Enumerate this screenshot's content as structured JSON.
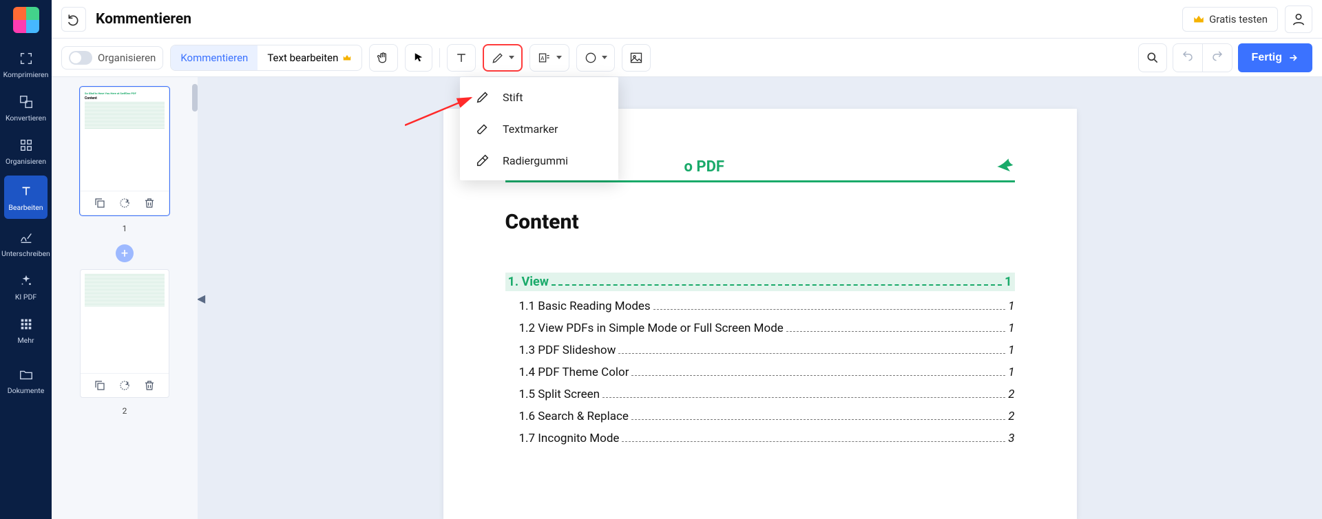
{
  "app_title": "Kommentieren",
  "topbar": {
    "trial_label": "Gratis testen"
  },
  "sidebar": {
    "items": [
      {
        "label": "Komprimieren"
      },
      {
        "label": "Konvertieren"
      },
      {
        "label": "Organisieren"
      },
      {
        "label": "Bearbeiten"
      },
      {
        "label": "Unterschreiben"
      },
      {
        "label": "KI PDF"
      },
      {
        "label": "Mehr"
      },
      {
        "label": "Dokumente"
      }
    ]
  },
  "toolbar": {
    "organize_label": "Organisieren",
    "tabs": {
      "annotate": "Kommentieren",
      "text": "Text bearbeiten"
    },
    "done_label": "Fertig"
  },
  "pen_dropdown": {
    "pen": "Stift",
    "marker": "Textmarker",
    "eraser": "Radiergummi"
  },
  "thumbnails": {
    "page1": "1",
    "page2": "2"
  },
  "document": {
    "header_title": "So Glad to Hav                     o PDF",
    "content_heading": "Content",
    "section": {
      "name": "1. View",
      "page": "1"
    },
    "toc": [
      {
        "name": "1.1 Basic Reading Modes",
        "page": "1"
      },
      {
        "name": "1.2 View PDFs in Simple Mode or Full Screen Mode",
        "page": "1"
      },
      {
        "name": "1.3 PDF Slideshow ",
        "page": "1"
      },
      {
        "name": "1.4 PDF Theme Color",
        "page": "1"
      },
      {
        "name": "1.5 Split Screen ",
        "page": "2"
      },
      {
        "name": "1.6 Search & Replace",
        "page": "2"
      },
      {
        "name": "1.7 Incognito Mode",
        "page": "3"
      }
    ]
  }
}
